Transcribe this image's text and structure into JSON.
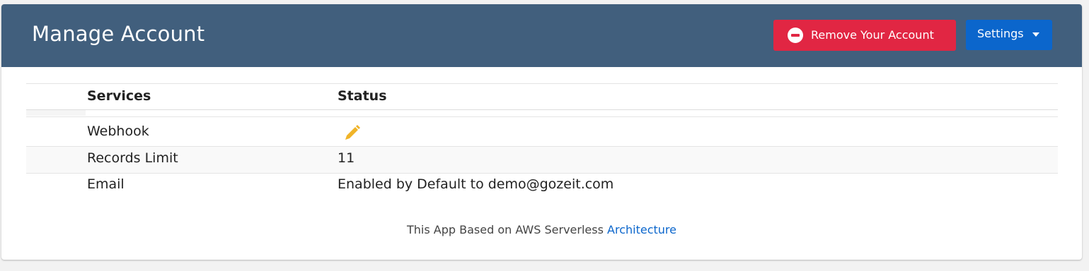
{
  "header": {
    "title": "Manage Account",
    "remove_button_label": "Remove Your Account",
    "settings_button_label": "Settings"
  },
  "table": {
    "columns": [
      "Services",
      "Status"
    ],
    "rows": [
      {
        "service": "Webhook",
        "status_icon": "pencil-icon"
      },
      {
        "service": "Records Limit",
        "status": "11"
      },
      {
        "service": "Email",
        "status": "Enabled by Default to demo@gozeit.com"
      }
    ]
  },
  "footer": {
    "text": "This App Based on AWS Serverless",
    "link_label": "Architecture"
  },
  "colors": {
    "header_bg": "#415f7d",
    "danger": "#e12643",
    "primary": "#0b66cc",
    "pencil": "#f0b429"
  }
}
